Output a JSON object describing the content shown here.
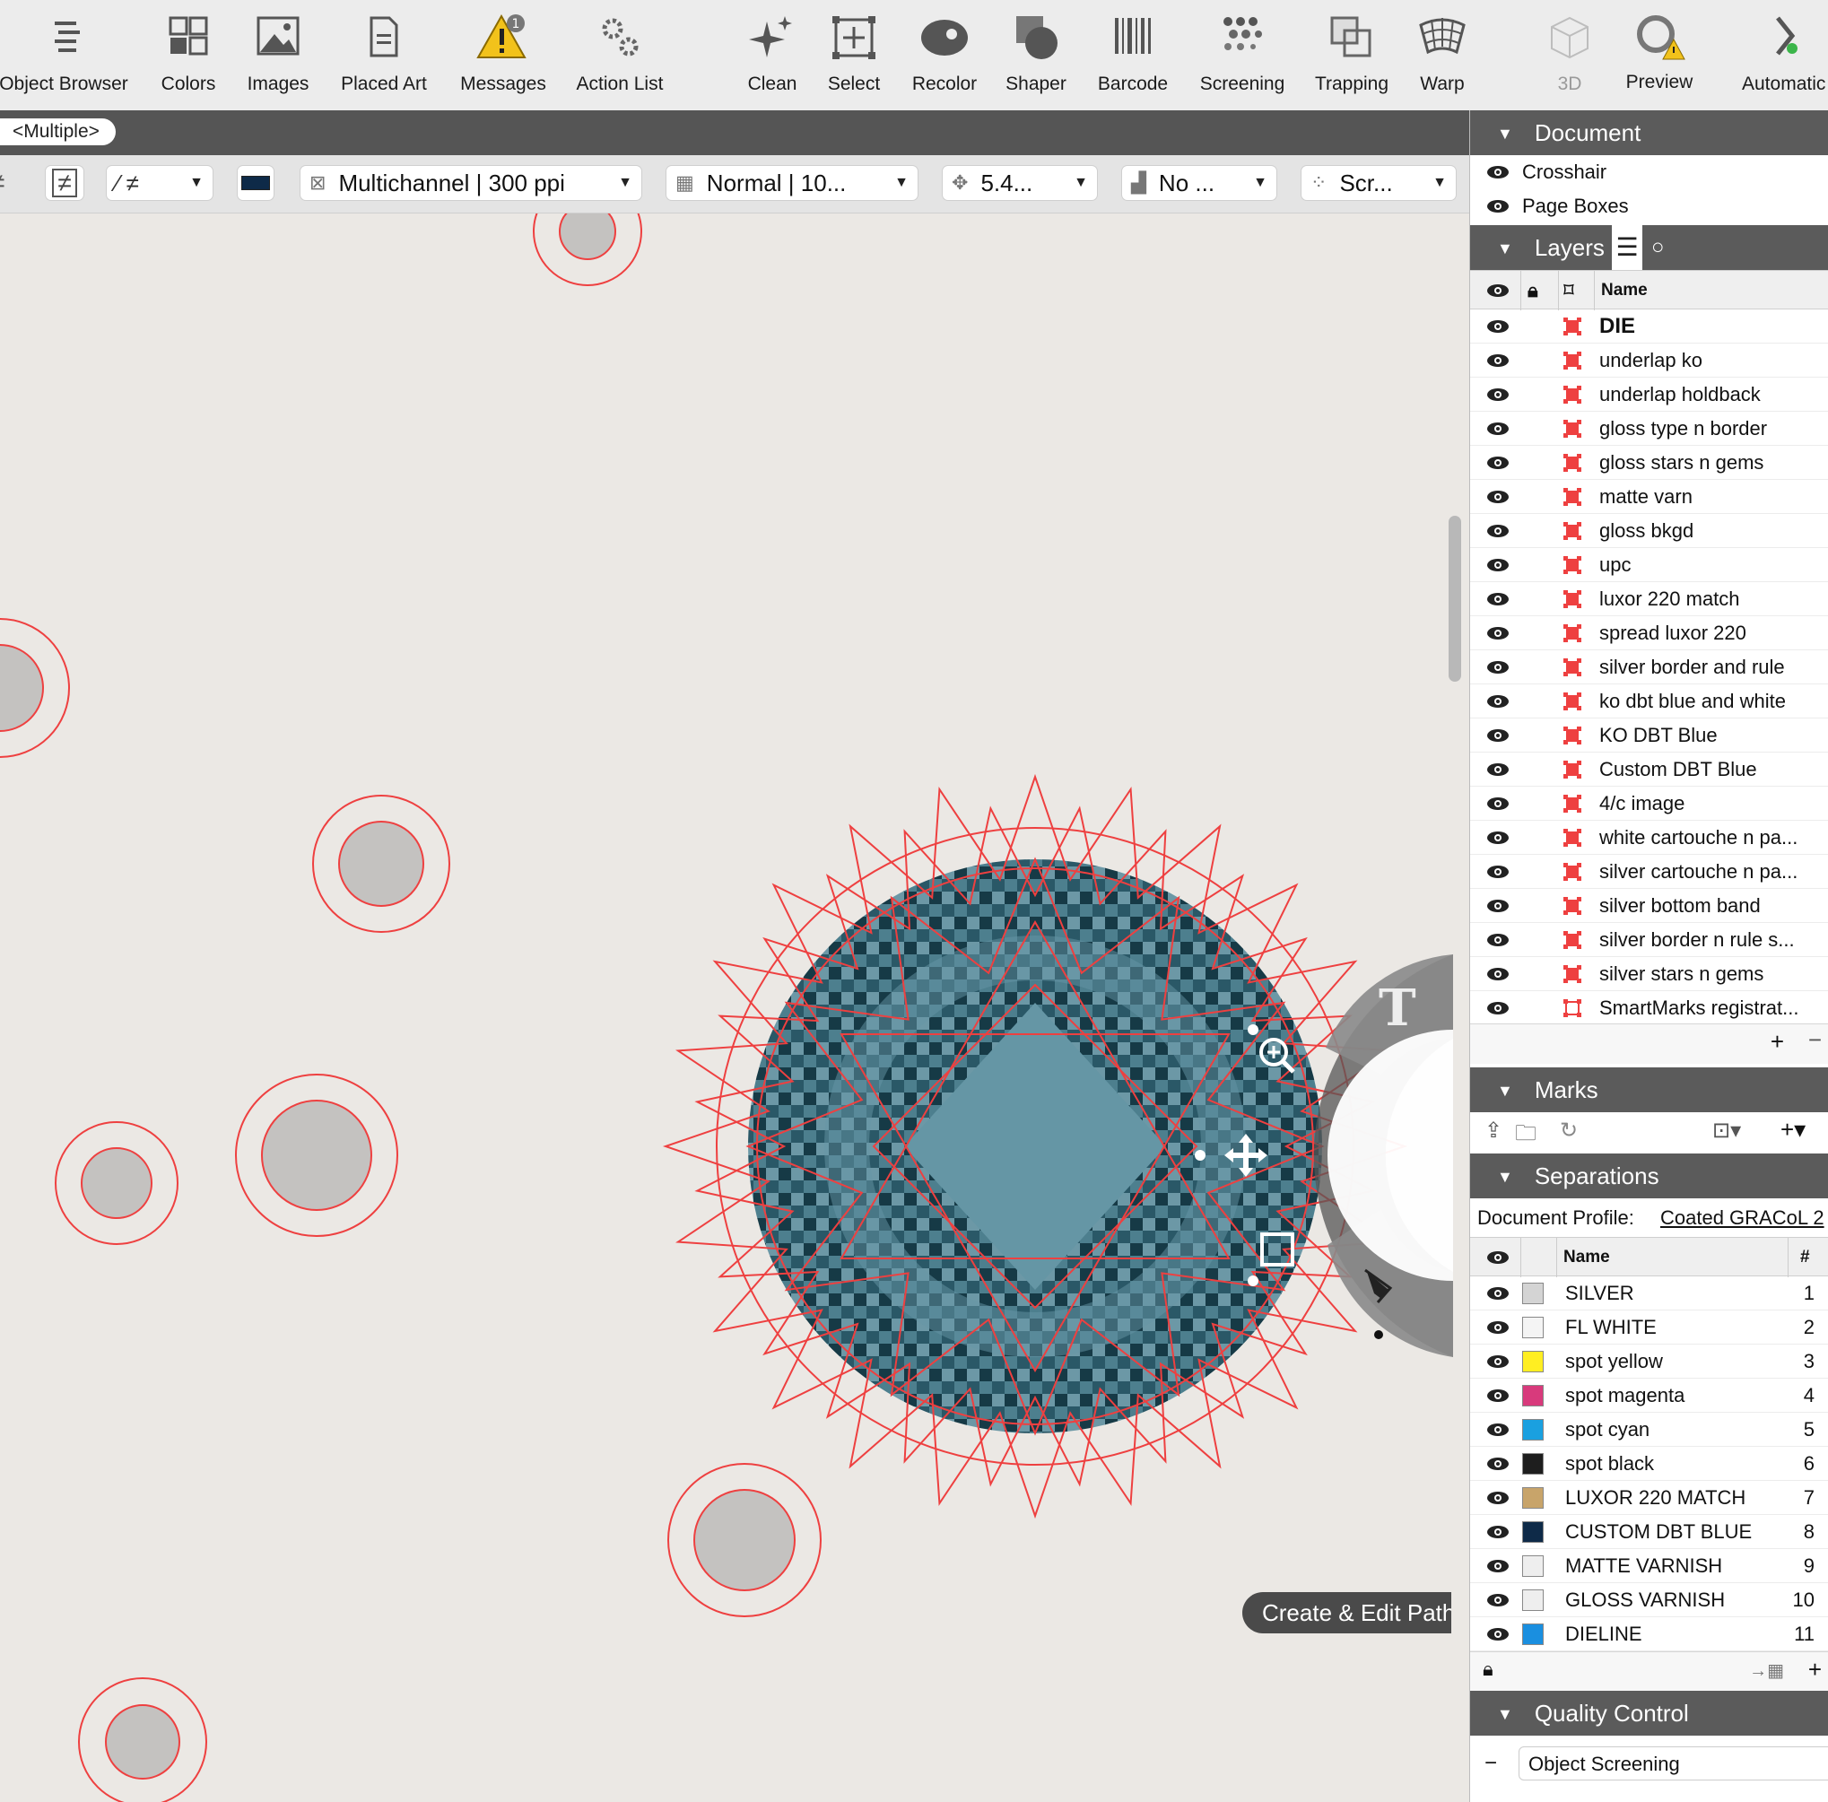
{
  "toolbar": {
    "items": [
      {
        "label": "Object Browser",
        "icon": "object-browser-icon"
      },
      {
        "label": "Colors",
        "icon": "colors-grid-icon"
      },
      {
        "label": "Images",
        "icon": "images-icon"
      },
      {
        "label": "Placed Art",
        "icon": "placed-art-icon"
      },
      {
        "label": "Messages",
        "icon": "warning-icon",
        "badge": "1"
      },
      {
        "label": "Action List",
        "icon": "gears-icon"
      },
      {
        "label": "Clean",
        "icon": "sparkle-icon"
      },
      {
        "label": "Select",
        "icon": "select-icon"
      },
      {
        "label": "Recolor",
        "icon": "palette-icon"
      },
      {
        "label": "Shaper",
        "icon": "shaper-icon"
      },
      {
        "label": "Barcode",
        "icon": "barcode-icon"
      },
      {
        "label": "Screening",
        "icon": "screening-icon"
      },
      {
        "label": "Trapping",
        "icon": "trapping-icon"
      },
      {
        "label": "Warp",
        "icon": "warp-icon"
      },
      {
        "label": "3D",
        "icon": "cube-icon",
        "disabled": true
      },
      {
        "label": "Preview",
        "icon": "preview-icon"
      },
      {
        "label": "Automatic",
        "icon": "automatic-icon"
      }
    ]
  },
  "selection": {
    "label": "<Multiple>"
  },
  "options": {
    "output": "Multichannel  |  300 ppi",
    "blend": "Normal  |  10...",
    "position": "5.4...",
    "shadow": "No ...",
    "screen": "Scr..."
  },
  "canvas": {
    "tooltip": "Create & Edit Path"
  },
  "panel": {
    "document": {
      "title": "Document",
      "items": [
        "Crosshair",
        "Page Boxes"
      ]
    },
    "layers": {
      "title": "Layers",
      "name_header": "Name",
      "items": [
        "DIE",
        "underlap ko",
        "underlap holdback",
        "gloss type n border",
        "gloss stars n gems",
        "matte varn",
        "gloss bkgd",
        "upc",
        "luxor 220 match",
        "spread luxor 220",
        "silver border and rule",
        "ko dbt blue and white",
        "KO DBT Blue",
        "Custom DBT Blue",
        "4/c image",
        "white cartouche n pa...",
        "silver cartouche n pa...",
        "silver bottom band",
        "silver border n rule s...",
        "silver stars n gems",
        "SmartMarks registrat..."
      ]
    },
    "marks": {
      "title": "Marks"
    },
    "separations": {
      "title": "Separations",
      "profile_label": "Document Profile:",
      "profile_value": "Coated GRACoL 2",
      "name_header": "Name",
      "num_header": "#",
      "items": [
        {
          "name": "SILVER",
          "num": "1",
          "color": "#d4d4d4"
        },
        {
          "name": "FL WHITE",
          "num": "2",
          "color": "#f4f4f4"
        },
        {
          "name": "spot yellow",
          "num": "3",
          "color": "#ffee22"
        },
        {
          "name": "spot magenta",
          "num": "4",
          "color": "#d83a7c"
        },
        {
          "name": "spot cyan",
          "num": "5",
          "color": "#1aa0e0"
        },
        {
          "name": "spot black",
          "num": "6",
          "color": "#1e1e1e"
        },
        {
          "name": "LUXOR 220 MATCH",
          "num": "7",
          "color": "#c8a46a"
        },
        {
          "name": "CUSTOM DBT BLUE",
          "num": "8",
          "color": "#0e2a48"
        },
        {
          "name": "MATTE VARNISH",
          "num": "9",
          "color": "#eeeeee"
        },
        {
          "name": "GLOSS VARNISH",
          "num": "10",
          "color": "#eeeeee"
        },
        {
          "name": "DIELINE",
          "num": "11",
          "color": "#1a8fe0"
        }
      ]
    },
    "quality": {
      "title": "Quality Control",
      "item": "Object Screening"
    }
  },
  "colors": {
    "accent_red": "#ee4040",
    "panel_header": "#5b5b5b"
  }
}
